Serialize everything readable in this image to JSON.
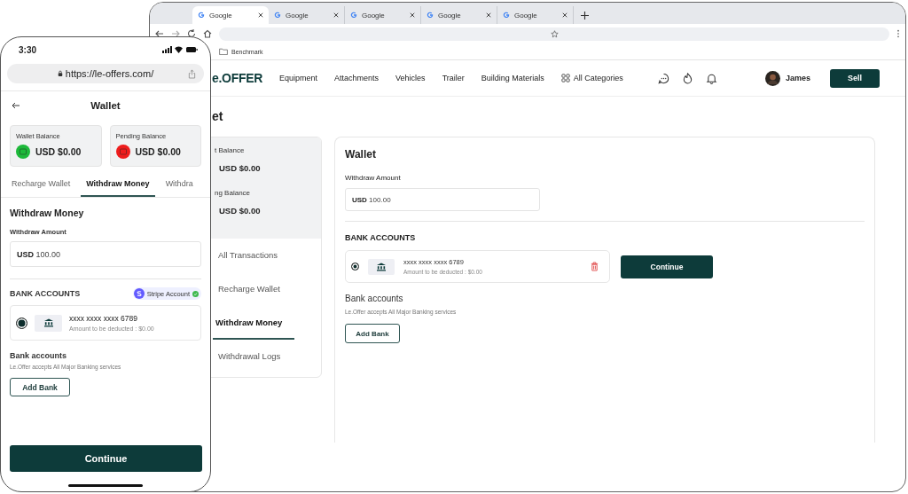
{
  "browser": {
    "tabs": [
      {
        "title": "Google",
        "selected": true
      },
      {
        "title": "Google",
        "selected": false
      },
      {
        "title": "Google",
        "selected": false
      },
      {
        "title": "Google",
        "selected": false
      },
      {
        "title": "Google",
        "selected": false
      }
    ],
    "bookmarks": [
      "Benchmark"
    ],
    "site": {
      "logo": "e.OFFER",
      "nav": [
        "Equipment",
        "Attachments",
        "Vehicles",
        "Trailer",
        "Building Materials"
      ],
      "all_categories": "All Categories",
      "user": "James",
      "sell": "Sell"
    },
    "page_title": "et",
    "sidebar": {
      "balances": [
        {
          "label": "t Balance",
          "amount": "USD $0.00"
        },
        {
          "label": "ng Balance",
          "amount": "USD $0.00"
        }
      ],
      "items": [
        {
          "label": "All Transactions",
          "selected": false
        },
        {
          "label": "Recharge Wallet",
          "selected": false
        },
        {
          "label": "Withdraw Money",
          "selected": true
        },
        {
          "label": "Withdrawal Logs",
          "selected": false
        }
      ]
    },
    "panel": {
      "title": "Wallet",
      "amount_label": "Withdraw Amount",
      "currency": "USD",
      "amount": "100.00",
      "bank_heading": "BANK ACCOUNTS",
      "accounts": [
        {
          "number": "xxxx xxxx xxxx 6789",
          "note": "Amount to be deducted : $0.00",
          "selected": true
        }
      ],
      "continue": "Continue",
      "bank_title": "Bank accounts",
      "bank_note": "Le.Offer accepts All Major Banking services",
      "add_bank": "Add Bank"
    }
  },
  "phone": {
    "time": "3:30",
    "url": "https://le-offers.com/",
    "title": "Wallet",
    "balances": [
      {
        "label": "Wallet Balance",
        "amount": "USD $0.00",
        "color": "#1db93a"
      },
      {
        "label": "Pending Balance",
        "amount": "USD $0.00",
        "color": "#ee1c1c"
      }
    ],
    "tabs": [
      {
        "label": "Recharge Wallet",
        "selected": false
      },
      {
        "label": "Withdraw Money",
        "selected": true
      },
      {
        "label": "Withdra",
        "selected": false
      }
    ],
    "section_title": "Withdraw Money",
    "amount_label": "Withdraw Amount",
    "currency": "USD",
    "amount": "100.00",
    "bank_heading": "BANK ACCOUNTS",
    "stripe": "Stripe Account",
    "accounts": [
      {
        "number": "xxxx xxxx xxxx 6789",
        "note": "Amount to be deducted : $0.00",
        "selected": true
      }
    ],
    "bank_title": "Bank accounts",
    "bank_note": "Le.Offer accepts All Major Banking services",
    "add_bank": "Add Bank",
    "continue": "Continue"
  }
}
